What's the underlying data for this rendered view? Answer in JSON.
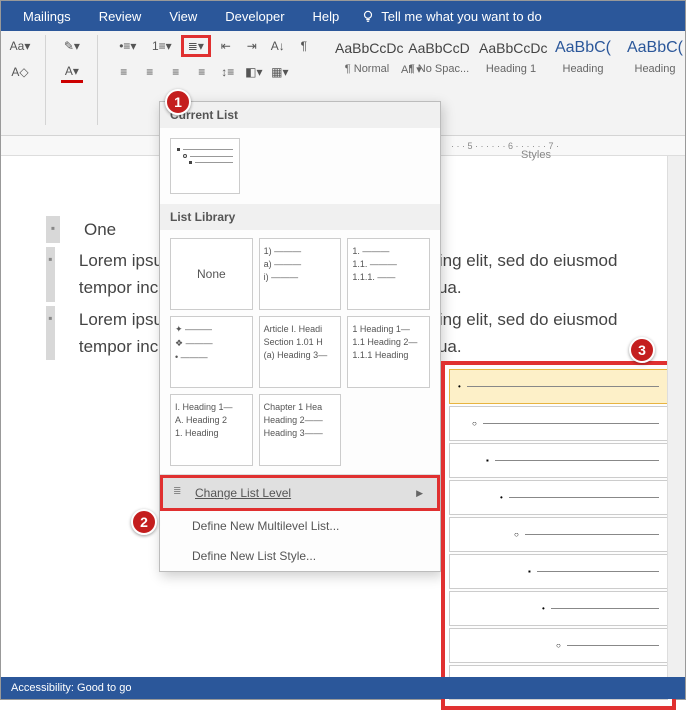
{
  "ribbon": {
    "tabs": [
      "Mailings",
      "Review",
      "View",
      "Developer",
      "Help"
    ],
    "tellme": "Tell me what you want to do"
  },
  "styles_gallery": {
    "all_label": "All ▾",
    "items": [
      {
        "preview": "AaBbCcDc",
        "name": "¶ Normal"
      },
      {
        "preview": "AaBbCcD",
        "name": "¶ No Spac..."
      },
      {
        "preview": "AaBbCcDc",
        "name": "Heading 1"
      },
      {
        "preview": "AaBbC(",
        "name": "Heading",
        "highlight": true
      },
      {
        "preview": "AaBbC(",
        "name": "Heading",
        "highlight": true
      }
    ],
    "group_label": "Styles"
  },
  "ruler_marks": "· · · 5 · · · · · · 6 · · · · · · 7 ·",
  "document": {
    "items": [
      "One",
      "Lorem ipsum dolor sit amet, consectetur adipiscing elit, sed do eiusmod tempor incididunt ut labore et dolore magna aliqua.",
      "Lorem ipsum dolor sit amet, consectetur adipiscing elit, sed do eiusmod tempor incididunt ut labore et dolore magna aliqua."
    ]
  },
  "ml_panel": {
    "current_header": "Current List",
    "library_header": "List Library",
    "none_label": "None",
    "library": [
      {
        "type": "none"
      },
      {
        "rows": [
          "1) ———",
          " a) ———",
          "  i) ———"
        ]
      },
      {
        "rows": [
          "1. ———",
          " 1.1. ———",
          "  1.1.1. ——"
        ]
      },
      {
        "rows": [
          "✦ ———",
          " ❖ ———",
          "  • ———"
        ]
      },
      {
        "rows": [
          "Article I. Headi",
          "Section 1.01 H",
          "(a) Heading 3—"
        ]
      },
      {
        "rows": [
          "1 Heading 1—",
          "1.1 Heading 2—",
          "1.1.1 Heading"
        ]
      },
      {
        "rows": [
          "I. Heading 1—",
          " A. Heading 2",
          "  1. Heading"
        ]
      },
      {
        "rows": [
          "Chapter 1 Hea",
          "Heading 2——",
          "Heading 3——"
        ]
      }
    ],
    "commands": {
      "change": "Change List Level",
      "define_ml": "Define New Multilevel List...",
      "define_style": "Define New List Style..."
    }
  },
  "level_flyout": {
    "levels": [
      {
        "indent": 0,
        "bullet": "•",
        "sel": true
      },
      {
        "indent": 14,
        "bullet": "○"
      },
      {
        "indent": 28,
        "bullet": "▪"
      },
      {
        "indent": 42,
        "bullet": "•"
      },
      {
        "indent": 56,
        "bullet": "○"
      },
      {
        "indent": 70,
        "bullet": "▪"
      },
      {
        "indent": 84,
        "bullet": "•"
      },
      {
        "indent": 98,
        "bullet": "○"
      },
      {
        "indent": 112,
        "bullet": "▪"
      }
    ]
  },
  "callouts": {
    "c1": "1",
    "c2": "2",
    "c3": "3"
  },
  "status": {
    "text": "Accessibility: Good to go"
  }
}
